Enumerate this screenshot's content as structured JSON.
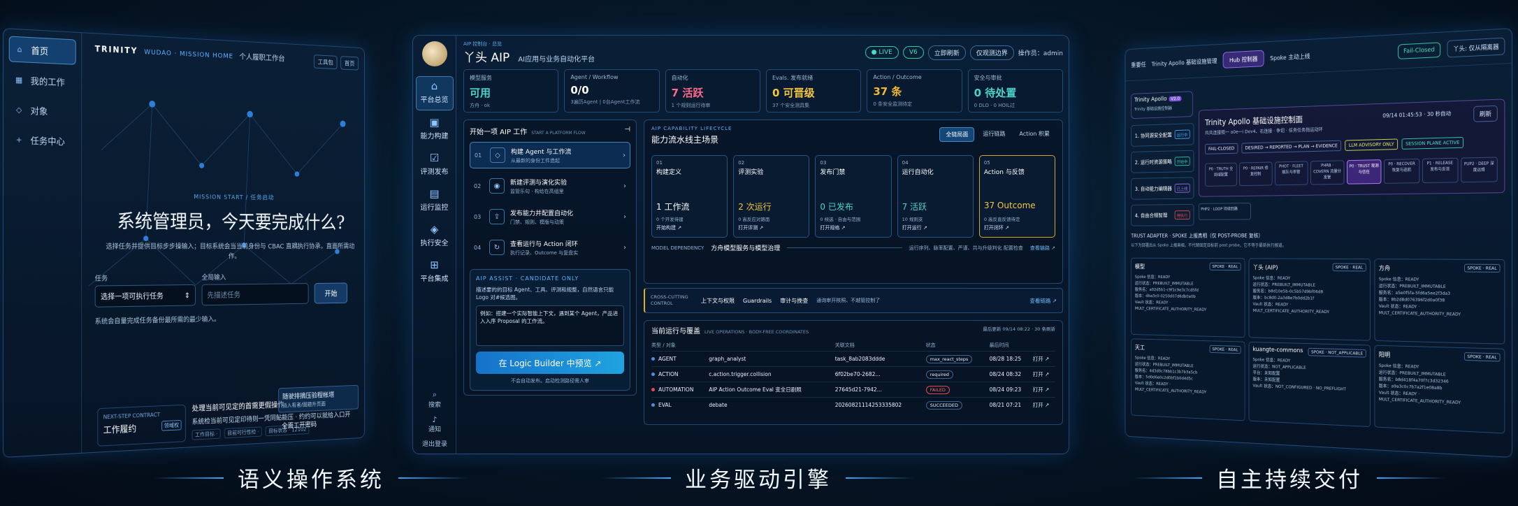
{
  "left": {
    "sidebar": [
      {
        "label": "首页",
        "icon": "home-icon",
        "active": true
      },
      {
        "label": "我的工作",
        "icon": "grid-icon",
        "active": false
      },
      {
        "label": "对象",
        "icon": "diamond-icon",
        "active": false
      },
      {
        "label": "任务中心",
        "icon": "plus-icon",
        "active": false
      }
    ],
    "brand": "TRINITY",
    "brand_sub": "WUDAO · MISSION HOME",
    "workspace": "个人履职工作台",
    "top_btns": [
      "工具包",
      "首页"
    ],
    "kicker": "MISSION START / 任务启动",
    "title": "系统管理员，今天要完成什么?",
    "desc": "选择任务并提供目标步步操输入；目标系统会当当前身份与 CBAC 直耦执行协承，直面所需动作。",
    "task_label": "任务",
    "task_value": "选择一项可执行任务",
    "input_label": "全局输入",
    "input_placeholder": "先描述任务",
    "go_label": "开始",
    "note": "系统会自量完成任务备份最所需的最少输入。",
    "contract_kicker": "NEXT-STEP CONTRACT",
    "contract_title": "工作履约",
    "contract_tag": "领域权",
    "task_title": "处理当前可见定的首需更假操作",
    "task_sub": "系统检当前可见定印待则一凭同鲇能压 · 约约可以就给入口开",
    "task_meta": [
      "工作目标 ·",
      "目前可行性检 ·",
      "目标状态 · 12102"
    ],
    "side_a": "随驶排摘压验程帐塔",
    "side_a_sub": "派入有者/图题升页面",
    "side_b": "全面工开密码"
  },
  "center": {
    "kicker": "AIP 控制台 · 总览",
    "title": "丫头 AIP",
    "subtitle": "AI应用与业务自动化平台",
    "live": "● LIVE",
    "version": "V6",
    "refresh": "立即刷新",
    "boundary": "仅观测边界",
    "operator": "操作员：admin",
    "nav": [
      {
        "label": "平台总览",
        "icon": "home-icon",
        "active": true
      },
      {
        "label": "能力构建",
        "icon": "cube-icon",
        "active": false
      },
      {
        "label": "评测发布",
        "icon": "check-doc-icon",
        "active": false
      },
      {
        "label": "运行监控",
        "icon": "clipboard-icon",
        "active": false
      },
      {
        "label": "执行安全",
        "icon": "shield-icon",
        "active": false
      },
      {
        "label": "平台集成",
        "icon": "plus-square-icon",
        "active": false
      }
    ],
    "foot": [
      "搜索",
      "通知",
      "退出登录"
    ],
    "kpis": [
      {
        "label": "模型服务",
        "value": "可用",
        "desc": "方舟 · ok",
        "color": "#4cd2c8"
      },
      {
        "label": "Agent / Workflow",
        "value": "0/0",
        "desc": "3遍历Agent | 0台Agent工作流",
        "color": "#ffffff"
      },
      {
        "label": "自动化",
        "value": "7 活跃",
        "desc": "1 个规则运行待审",
        "color": "#ff6a8a"
      },
      {
        "label": "Evals. 发布就绪",
        "value": "0 可晋级",
        "desc": "37 个安全测具集",
        "color": "#f5c542"
      },
      {
        "label": "Action / Outcome",
        "value": "37 条",
        "desc": "0 条安全监测待定",
        "color": "#f5b833"
      },
      {
        "label": "安全与审批",
        "value": "0 待处置",
        "desc": "0 DLO · 0 HOIL过",
        "color": "#4cd2c8"
      }
    ],
    "flow_title": "开始一项 AIP 工作",
    "flow_sub": "START A PLATFORM FLOW",
    "steps": [
      {
        "n": "01",
        "title": "构建 Agent 与工作流",
        "sub": "从最新的身份工件造起",
        "icon": "diamond-icon",
        "active": true
      },
      {
        "n": "02",
        "title": "新建评测与演化实验",
        "sub": "监管乐句 · 构给在高组里",
        "icon": "circle-icon",
        "active": false
      },
      {
        "n": "03",
        "title": "发布能力并配置自动化",
        "sub": "门禁、规则、模版与动策",
        "icon": "upload-icon",
        "active": false
      },
      {
        "n": "04",
        "title": "查看运行与 Action 闭环",
        "sub": "执行记录、Outcome 与复盘实",
        "icon": "loop-icon",
        "active": false
      }
    ],
    "assist_kicker": "AIP ASSIST · CANDIDATE ONLY",
    "assist_desc": "描述要的的目标 Agent、工具、评测和规整，自然语言只能 Logo 对#候选图。",
    "assist_text": "例如：搭建一个实际智能上下文，遇到某个 Agent，产品进入入序 Proposal 的工作流。",
    "assist_btn": "在 Logic Builder 中预览 ↗",
    "assist_foot": "不会自动发布。启动检测路径需人审",
    "life_kicker": "AIP CAPABILITY LIFECYCLE",
    "life_title": "能力流水线主场景",
    "life_tabs": [
      "全链局面",
      "运行链路",
      "Action 积累"
    ],
    "stages": [
      {
        "n": "01",
        "name": "构建定义",
        "value": "1 工作流",
        "sm": "0 个开发待建",
        "link": "开始构建 ↗",
        "color": "#ffffff",
        "gold": false
      },
      {
        "n": "02",
        "name": "评测实验",
        "value": "2 次运行",
        "sm": "0 高反应对路面",
        "link": "打开评测 ↗",
        "color": "#f5c542",
        "gold": false
      },
      {
        "n": "03",
        "name": "发布门禁",
        "value": "0 已发布",
        "sm": "0 候选 · 自由与范围",
        "link": "打开规格 ↗",
        "color": "#4cd2c8",
        "gold": false
      },
      {
        "n": "04",
        "name": "运行自动化",
        "value": "7 活跃",
        "sm": "10 规则支",
        "link": "打开运行 ↗",
        "color": "#4cd2c8",
        "gold": false
      },
      {
        "n": "05",
        "name": "Action 与反馈",
        "value": "37 Outcome",
        "sm": "0 高反直反馈待定",
        "link": "打开闭环 ↗",
        "color": "#f5c542",
        "gold": true
      }
    ],
    "dep_k": "MODEL DEPENDENCY",
    "dep_t": "方舟模型服务与模型治理",
    "dep_d": "运行序列、脉率配置、严谨、共与升级判化 配置检查",
    "dep_link": "查看链路 ↗",
    "cross_k": "CROSS-CUTTING CONTROL",
    "cross_items": [
      "上下文与权限",
      "Guardrails",
      "审计与挽查"
    ],
    "cross_x": "通询审开核照、不越管控制了",
    "cross_link": "查看链路 ↗",
    "ops_title": "当前运行与覆盖",
    "ops_sub": "LIVE OPERATIONS · BODY-FREE COORDINATES",
    "ops_right": "最后更新 09/14 08:22 · 30 条刷新",
    "ops_cols": [
      "类型 / 对象",
      "",
      "关联文档",
      "状态",
      "最后时间",
      ""
    ],
    "ops_rows": [
      {
        "dot": "#4a8fe0",
        "type": "AGENT",
        "obj": "graph_analyst",
        "doc": "task_8ab2083ddde",
        "status": "max_react_steps",
        "fail": false,
        "time": "08/28 18:25",
        "open": "打开 ↗"
      },
      {
        "dot": "#4a8fe0",
        "type": "ACTION",
        "obj": "c.action.trigger.collision",
        "doc": "6f02be70-2682...",
        "status": "required",
        "fail": false,
        "time": "08/24 08:32",
        "open": "打开 ↗"
      },
      {
        "dot": "#e24c4c",
        "type": "AUTOMATION",
        "obj": "AIP Action Outcome Eval 变全日剧照",
        "doc": "27645d21-7942...",
        "status": "FAILED",
        "fail": true,
        "time": "08/24 09:23",
        "open": "打开 ↗"
      },
      {
        "dot": "#4a8fe0",
        "type": "EVAL",
        "obj": "debate",
        "doc": "20260821114253335802",
        "status": "SUCCEEDED",
        "fail": false,
        "time": "08/21 07:21",
        "open": "打开 ↗"
      }
    ]
  },
  "right": {
    "top_home": "重要任",
    "top_title": "Trinity Apollo 基础设施管理",
    "hub": "Hub 控制器",
    "spoke": "Spoke 主动上线",
    "failclosed": "Fail-Closed",
    "ai": "丫头: 仅从隔离器",
    "app_title": "Trinity Apollo",
    "app_ver": "V2.0",
    "app_sub": "Trinity 基础设施控制器",
    "steps": [
      {
        "label": "1. 协同源安全配置",
        "badge": "运行中",
        "color": "#3aa8ff"
      },
      {
        "label": "2. 运行时资源策略",
        "badge": "开始中",
        "color": "#2fc7a6"
      },
      {
        "label": "3. 自动能力编辑器",
        "badge": "已上线",
        "color": "#9a6cf0"
      },
      {
        "label": "4. 自由合规智理",
        "badge": "待执行",
        "color": "#e24c4c"
      }
    ],
    "hero_title": "Trinity Apollo 基础设施控制面",
    "hero_desc": "共共连接照一 o0e一i Dev4、右连接 · 争切 · 任务任务指运动环",
    "hero_time": "09/14 01:45:53 · 30 秒自动",
    "hero_refresh": "刷新",
    "tags": [
      {
        "label": "FAIL-CLOSED",
        "cls": ""
      },
      {
        "label": "DESIRED → REPORTED → PLAN → EVIDENCE",
        "cls": ""
      },
      {
        "label": "LLM ADVISORY ONLY",
        "cls": "y"
      },
      {
        "label": "SESSION PLANE ACTIVE",
        "cls": "g"
      }
    ],
    "nodes": [
      {
        "label": "P0 · TRUTH 全局域配置",
        "on": false
      },
      {
        "label": "P0 · REPAIR 修复控制",
        "on": false
      },
      {
        "label": "PHOT · FLEET 舰队与审管",
        "on": false
      },
      {
        "label": "PHRB · COVERN 流量分发管",
        "on": false
      },
      {
        "label": "P0 · TRUST 观测与信任",
        "on": true
      },
      {
        "label": "P0 · RECOVER 恢复与巡航",
        "on": false
      },
      {
        "label": "P1 · RELEASE 发布与反显",
        "on": false
      },
      {
        "label": "PUP2 · DEEP 深度运维",
        "on": false
      }
    ],
    "loop": "PHP2 · LOOP 持续回路",
    "trust_title": "TRUST ADAPTER · SPOKE 上报真相（仅 POST-PROBE 复核）",
    "trust_sub": "以下为部署后从 Spoke 上报真相，不代替固定目标前 post probe，它不等于最新执行报道。",
    "cards": [
      {
        "name": "模型",
        "tag": "SPOKE · REAL",
        "lines": [
          "Spoke 信息：READY",
          "运行状态：PREBUILT_IMMUTABLE",
          "服务名：a02d5b1-c9f1c9e3c7cd5fd",
          "版本：dba3c0-0250d07d6db0a0b",
          "Vault 状态：READY · MULT_CERTIFICATE_AUTHORITY_READY"
        ]
      },
      {
        "name": "丫头 (AIP)",
        "tag": "SPOKE · REAL",
        "lines": [
          "Spoke 信息：READY",
          "运行状态：PREBUILT_IMMUTABLE",
          "服务名：b8d10e5b-0c5b57d9bf06d8",
          "版本：bc8d0-2a3d8e7b0dd2b1f",
          "Vault 状态：READY · MULT_CERTIFICATE_AUTHORITY_READY"
        ]
      },
      {
        "name": "方舟",
        "tag": "SPOKE · REAL",
        "lines": [
          "Spoke 信息：READY",
          "运行状态：PREBUILT_IMMUTABLE",
          "服务名：a5e0f5fa-5fd6a5ee2f3da3",
          "版本：8b2d8d076396f2d0a0f38",
          "Vault 状态：READY · MULT_CERTIFICATE_AUTHORITY_READY"
        ]
      },
      {
        "name": "天工",
        "tag": "SPOKE · REAL",
        "lines": [
          "Spoke 信息：READY",
          "运行状态：PREBUILT_IMMUTABLE",
          "服务名：4d3d0c78bb1c3b7b3a5cb",
          "版本：5d0d6e0c2d0bf1b0d4d5c",
          "Vault 状态：READY · MULT_CERTIFICATE_AUTHORITY_READY"
        ]
      },
      {
        "name": "kuangte-commons",
        "tag": "SPOKE · NOT_APPLICABLE",
        "lines": [
          "Spoke 信息：READY",
          "运行状态：NOT_APPLICABLE",
          "平台：未知配置",
          "版本：未知配置",
          "Vault 状态：NOT_CONFIGURED · NO_PREFLIGHT"
        ]
      },
      {
        "name": "阳明",
        "tag": "SPOKE · REAL",
        "lines": [
          "Spoke 信息：READY",
          "运行状态：PREBUILT_IMMUTABLE",
          "服务名：b8d418f4a70f7c3d32346",
          "版本：a9a3c0c7b7a2f1e08a8b",
          "Vault 状态：READY · MULT_CERTIFICATE_AUTHORITY_READY"
        ]
      }
    ]
  },
  "captions": [
    "语义操作系统",
    "业务驱动引擎",
    "自主持续交付"
  ]
}
